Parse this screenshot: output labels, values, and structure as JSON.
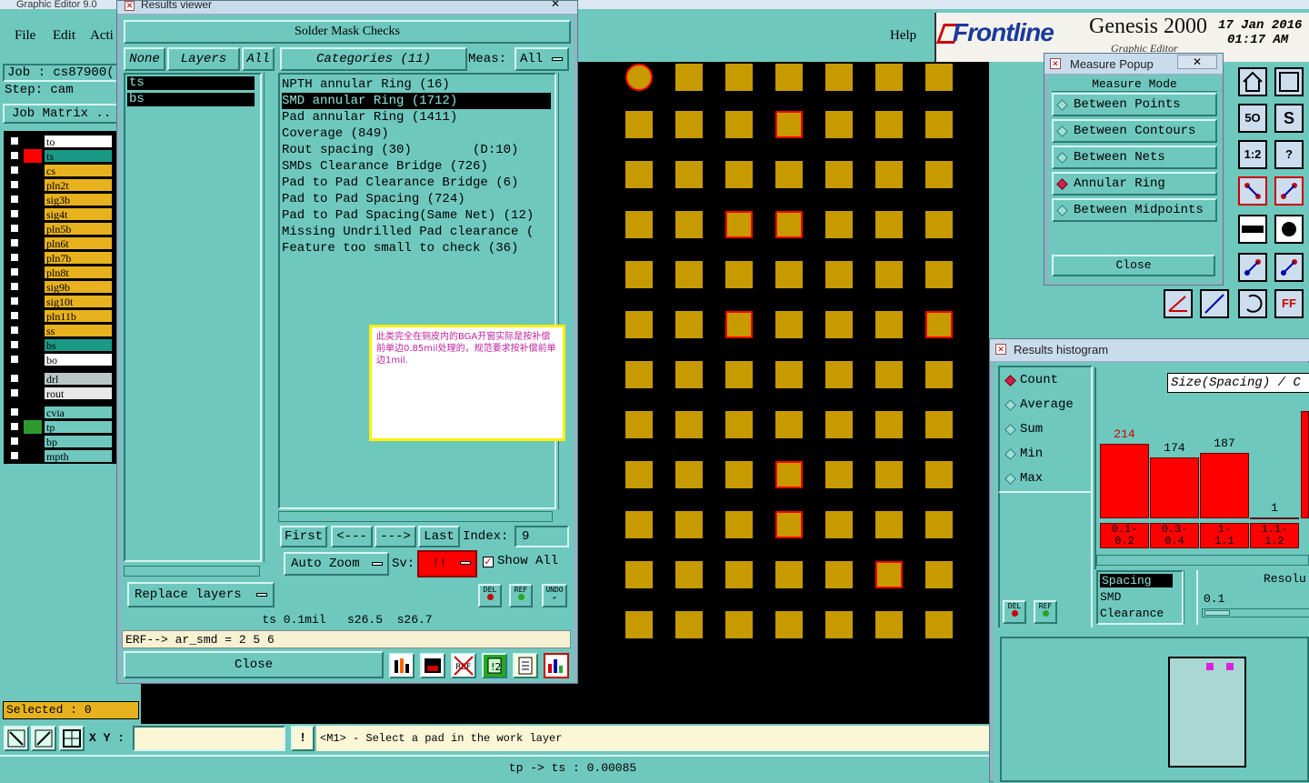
{
  "main": {
    "title": "Graphic Editor 9.0",
    "menu": [
      "File",
      "Edit",
      "Acti"
    ],
    "help": "Help",
    "brand": "Frontline",
    "product": "Genesis 2000",
    "product_sub": "Graphic Editor",
    "date": "17 Jan 2016",
    "time": "01:17 AM",
    "job_label": "Job : cs87900(",
    "step_label": "Step: cam",
    "job_matrix": "Job Matrix ..",
    "selected": "Selected : 0",
    "xy_label": "X Y :",
    "prompt": "<M1> - Select a pad in the work layer",
    "status": "tp -> ts : 0.00085"
  },
  "layers": [
    {
      "name": "to",
      "swatch": "#000000",
      "color": "#ffffff"
    },
    {
      "name": "ts",
      "swatch": "#ff0000",
      "color": "#1a9a86"
    },
    {
      "name": "cs",
      "swatch": "#000000",
      "color": "#e7b21e"
    },
    {
      "name": "pln2t",
      "swatch": "#000000",
      "color": "#e7b21e"
    },
    {
      "name": "sig3b",
      "swatch": "#000000",
      "color": "#e7b21e"
    },
    {
      "name": "sig4t",
      "swatch": "#000000",
      "color": "#e7b21e"
    },
    {
      "name": "pln5b",
      "swatch": "#000000",
      "color": "#e7b21e"
    },
    {
      "name": "pln6t",
      "swatch": "#000000",
      "color": "#e7b21e"
    },
    {
      "name": "pln7b",
      "swatch": "#000000",
      "color": "#e7b21e"
    },
    {
      "name": "pln8t",
      "swatch": "#000000",
      "color": "#e7b21e"
    },
    {
      "name": "sig9b",
      "swatch": "#000000",
      "color": "#e7b21e"
    },
    {
      "name": "sig10t",
      "swatch": "#000000",
      "color": "#e7b21e"
    },
    {
      "name": "pln11b",
      "swatch": "#000000",
      "color": "#e7b21e"
    },
    {
      "name": "ss",
      "swatch": "#000000",
      "color": "#e7b21e"
    },
    {
      "name": "bs",
      "swatch": "#000000",
      "color": "#1a9a86"
    },
    {
      "name": "bo",
      "swatch": "#000000",
      "color": "#ffffff"
    }
  ],
  "layers2": [
    {
      "name": "drl",
      "swatch": "#000000",
      "color": "#b8c8c8"
    },
    {
      "name": "rout",
      "swatch": "#000000",
      "color": "#e8e8e8"
    },
    {
      "name": "cvia",
      "swatch": "#000000",
      "color": "#6fc8be"
    },
    {
      "name": "tp",
      "swatch": "#2e9a2e",
      "color": "#6fc8be"
    },
    {
      "name": "bp",
      "swatch": "#000000",
      "color": "#6fc8be"
    },
    {
      "name": "mpth",
      "swatch": "#000000",
      "color": "#6fc8be"
    }
  ],
  "results_viewer": {
    "title": "Results viewer",
    "close_x": "✕",
    "header": "Solder Mask Checks",
    "none": "None",
    "layers": "Layers",
    "all": "All",
    "categories": "Categories (11)",
    "meas_label": "Meas:",
    "meas_value": "All",
    "layer_list": [
      "ts",
      "bs"
    ],
    "category_list": [
      "NPTH annular Ring (16)",
      "SMD annular Ring (1712)",
      "Pad annular Ring (1411)",
      "Coverage (849)",
      "Rout spacing (30)        (D:10)",
      "SMDs Clearance Bridge (726)",
      "Pad to Pad Clearance Bridge (6)",
      "Pad to Pad Spacing (724)",
      "Pad to Pad Spacing(Same Net) (12)",
      "Missing Undrilled Pad clearance (",
      "Feature too small to check (36)"
    ],
    "selected_index": 1,
    "note": "此类完全在铜皮内的BGA开窗实际是按补偿前单边0.85mil处理的，规范要求按补偿前单边1mil.",
    "first": "First",
    "prev": "<---",
    "next": "--->",
    "last": "Last",
    "index_label": "Index:",
    "index_value": "9",
    "auto_zoom": "Auto Zoom",
    "sv_label": "Sv:",
    "sv_value": "!!",
    "show_all": "Show All",
    "replace_layers": "Replace layers",
    "del": "DEL",
    "ref": "REF",
    "undo": "UNDO",
    "info": "ts 0.1mil   s26.5  s26.7",
    "erf": "ERF--> ar_smd = 2 5 6",
    "close": "Close"
  },
  "measure_popup": {
    "title": "Measure Popup",
    "close_x": "✕",
    "mode_header": "Measure Mode",
    "modes": [
      "Between Points",
      "Between Contours",
      "Between Nets",
      "Annular Ring",
      "Between Midpoints"
    ],
    "selected_mode": 3,
    "close": "Close"
  },
  "histogram": {
    "title": "Results histogram",
    "modes": [
      "Count",
      "Average",
      "Sum",
      "Min",
      "Max"
    ],
    "selected_mode": 0,
    "axis_title": "Size(Spacing) / C",
    "del": "DEL",
    "ref": "REF",
    "types": [
      "Spacing",
      "SMD",
      "Clearance"
    ],
    "resolution_label": "Resolu",
    "resolution_value": "0.1"
  },
  "chart_data": {
    "type": "bar",
    "title": "",
    "xlabel": "Size(Spacing) / C",
    "ylabel": "",
    "categories": [
      "0.1-\n0.2",
      "0.3-\n0.4",
      "1-\n1.1",
      "1.1-\n1.2"
    ],
    "values": [
      214,
      174,
      187,
      1
    ],
    "ylim": [
      0,
      260
    ]
  }
}
